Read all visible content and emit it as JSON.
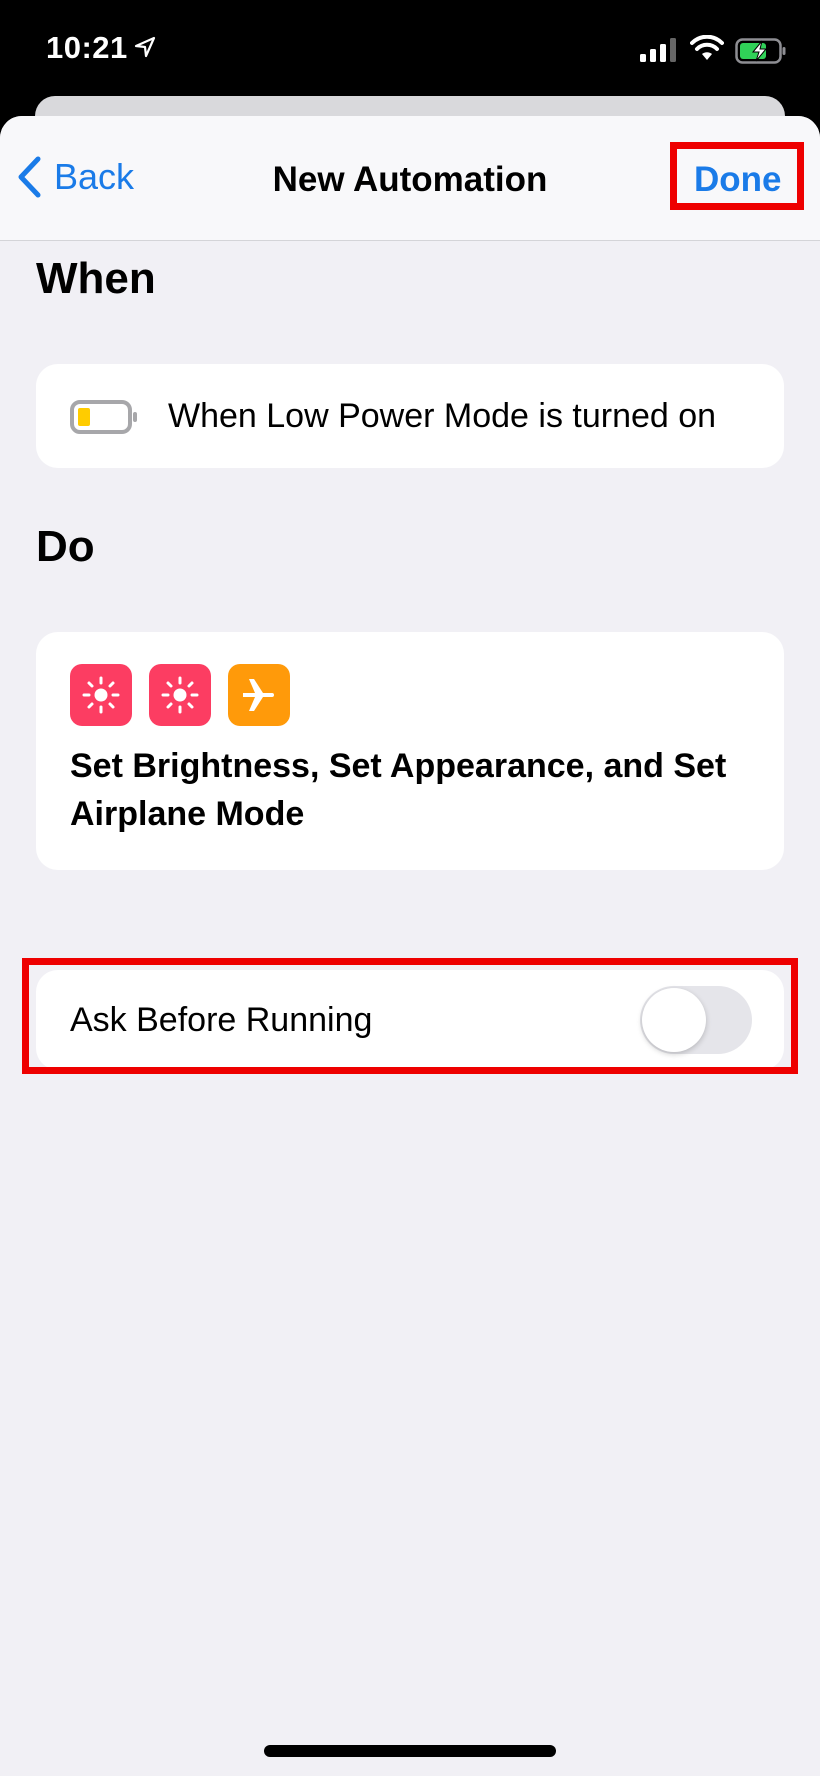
{
  "status_bar": {
    "time": "10:21",
    "location_icon": "location-arrow-icon",
    "signal_icon": "cellular-signal-icon",
    "wifi_icon": "wifi-icon",
    "battery_icon": "battery-charging-icon",
    "battery_color": "#30d158"
  },
  "nav": {
    "back_label": "Back",
    "back_icon": "chevron-left-icon",
    "title": "New Automation",
    "done_label": "Done",
    "accent_color": "#1a7be8"
  },
  "when": {
    "section_title": "When",
    "trigger_icon": "low-battery-icon",
    "trigger_text": "When Low Power Mode is turned on"
  },
  "do": {
    "section_title": "Do",
    "actions": [
      {
        "icon": "brightness-icon",
        "color": "#fc3d62"
      },
      {
        "icon": "brightness-icon",
        "color": "#fc3d62"
      },
      {
        "icon": "airplane-icon",
        "color": "#ff9a0a"
      }
    ],
    "summary": "Set Brightness, Set Appearance, and Set Airplane Mode"
  },
  "ask_before_running": {
    "label": "Ask Before Running",
    "enabled": false
  },
  "annotations": {
    "highlight_color": "#ee0000",
    "highlighted": [
      "Done",
      "Ask Before Running"
    ]
  }
}
